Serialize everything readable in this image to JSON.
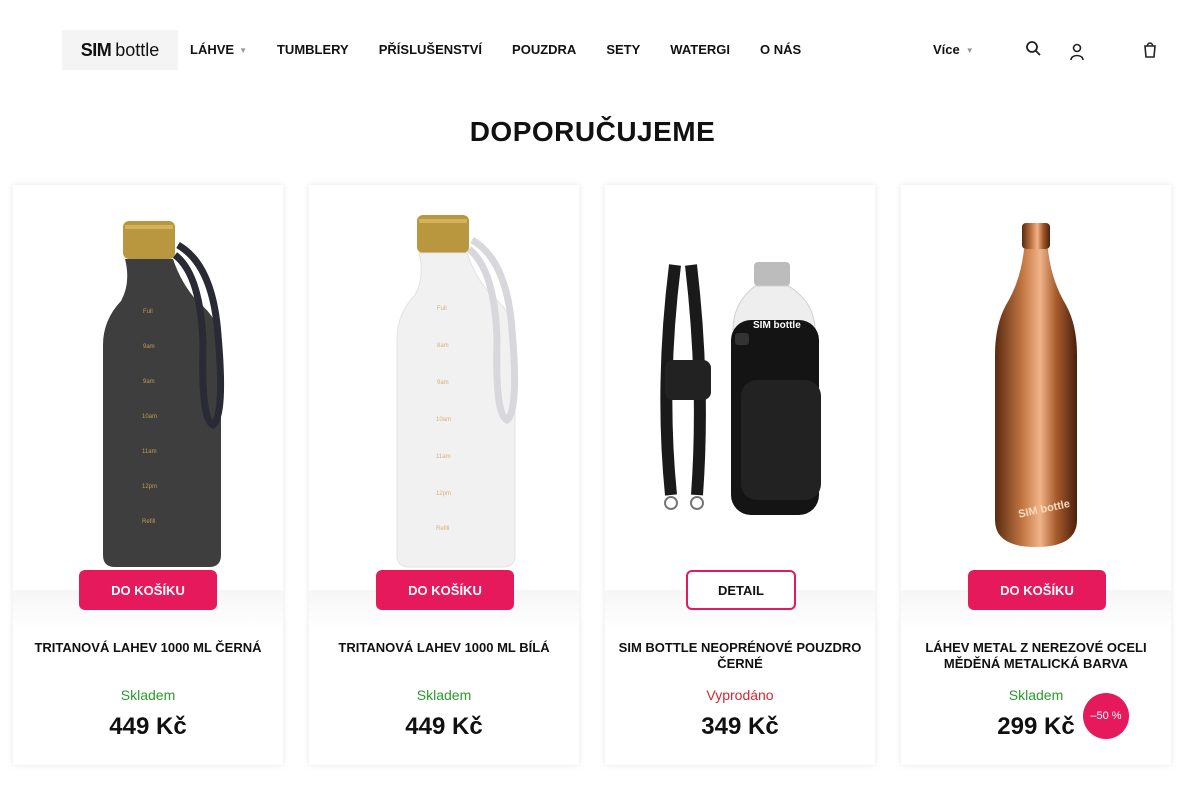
{
  "header": {
    "logo": {
      "bold": "SIM",
      "light": "bottle"
    },
    "nav": [
      {
        "label": "LÁHVE",
        "has_dropdown": true
      },
      {
        "label": "TUMBLERY",
        "has_dropdown": false
      },
      {
        "label": "PŘÍSLUŠENSTVÍ",
        "has_dropdown": false
      },
      {
        "label": "POUZDRA",
        "has_dropdown": false
      },
      {
        "label": "SETY",
        "has_dropdown": false
      },
      {
        "label": "WATERGI",
        "has_dropdown": false
      },
      {
        "label": "O NÁS",
        "has_dropdown": false
      }
    ],
    "more_label": "Více",
    "icons": [
      "search-icon",
      "user-icon",
      "cart-icon"
    ]
  },
  "section_title": "DOPORUČUJEME",
  "colors": {
    "accent": "#e5195b",
    "in_stock": "#2a9a2a",
    "out_of_stock": "#d8262e"
  },
  "products": [
    {
      "name": "TRITANOVÁ LAHEV 1000 ML ČERNÁ",
      "button": "DO KOŠÍKU",
      "stock": "Skladem",
      "price": "449 Kč",
      "image": "black-tritan-bottle"
    },
    {
      "name": "TRITANOVÁ LAHEV 1000 ML BÍLÁ",
      "button": "DO KOŠÍKU",
      "stock": "Skladem",
      "price": "449 Kč",
      "image": "white-tritan-bottle"
    },
    {
      "name": "SIM BOTTLE NEOPRÉNOVÉ POUZDRO ČERNÉ",
      "button": "DETAIL",
      "stock": "Vyprodáno",
      "price": "349 Kč",
      "image": "neoprene-case",
      "image_text": "SIM bottle"
    },
    {
      "name": "LÁHEV METAL Z NEREZOVÉ OCELI MĚDĚNÁ METALICKÁ BARVA",
      "button": "DO KOŠÍKU",
      "stock": "Skladem",
      "price": "299 Kč",
      "badge": "–50 %",
      "image": "copper-metal-bottle",
      "image_text": "SIM bottle"
    }
  ]
}
